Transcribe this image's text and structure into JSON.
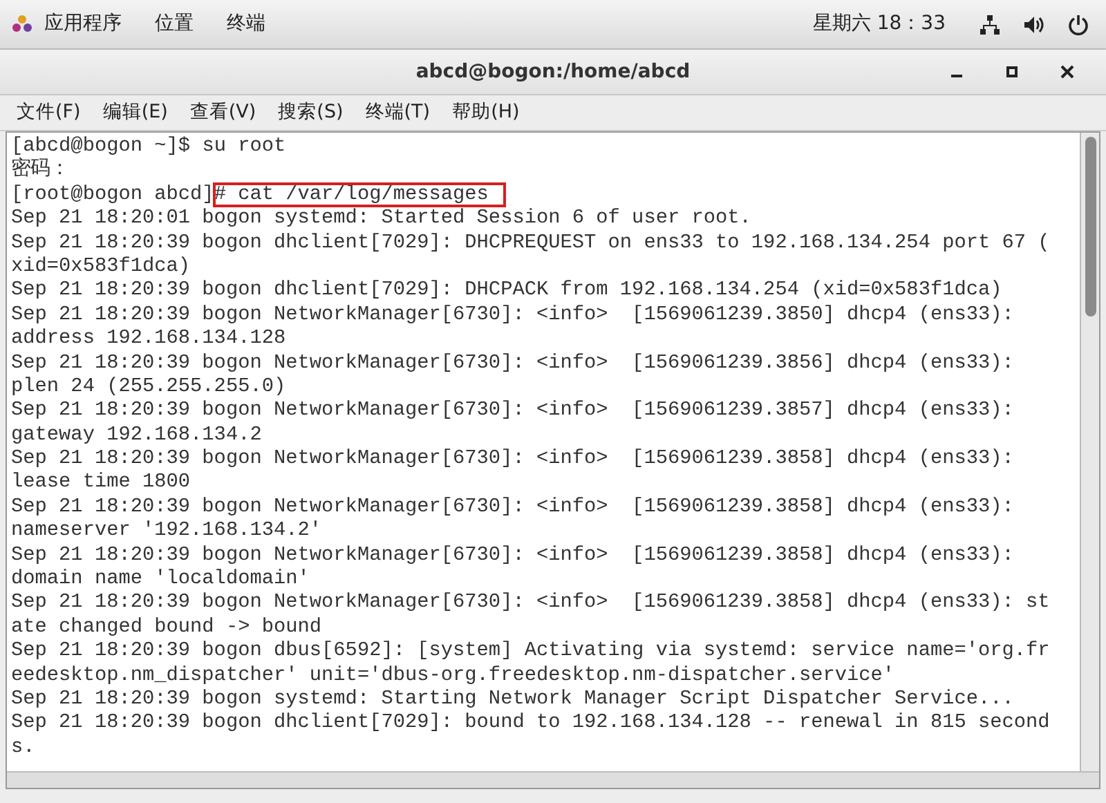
{
  "top_bar": {
    "menus": [
      "应用程序",
      "位置",
      "终端"
    ],
    "clock": "星期六 18：33"
  },
  "window": {
    "title": "abcd@bogon:/home/abcd"
  },
  "menu_bar": [
    "文件(F)",
    "编辑(E)",
    "查看(V)",
    "搜索(S)",
    "终端(T)",
    "帮助(H)"
  ],
  "terminal": {
    "lines": [
      {
        "kind": "prompt",
        "prompt": "[abcd@bogon ~]$ ",
        "command": "su root",
        "highlighted": false
      },
      {
        "kind": "output",
        "text": "密码："
      },
      {
        "kind": "prompt",
        "prompt": "[root@bogon abcd]",
        "command": "# cat /var/log/messages",
        "highlighted": true
      },
      {
        "kind": "output",
        "text": "Sep 21 18:20:01 bogon systemd: Started Session 6 of user root."
      },
      {
        "kind": "output",
        "text": "Sep 21 18:20:39 bogon dhclient[7029]: DHCPREQUEST on ens33 to 192.168.134.254 port 67 ("
      },
      {
        "kind": "output",
        "text": "xid=0x583f1dca)"
      },
      {
        "kind": "output",
        "text": "Sep 21 18:20:39 bogon dhclient[7029]: DHCPACK from 192.168.134.254 (xid=0x583f1dca)"
      },
      {
        "kind": "output",
        "text": "Sep 21 18:20:39 bogon NetworkManager[6730]: <info>  [1569061239.3850] dhcp4 (ens33):"
      },
      {
        "kind": "output",
        "text": "address 192.168.134.128"
      },
      {
        "kind": "output",
        "text": "Sep 21 18:20:39 bogon NetworkManager[6730]: <info>  [1569061239.3856] dhcp4 (ens33):"
      },
      {
        "kind": "output",
        "text": "plen 24 (255.255.255.0)"
      },
      {
        "kind": "output",
        "text": "Sep 21 18:20:39 bogon NetworkManager[6730]: <info>  [1569061239.3857] dhcp4 (ens33):"
      },
      {
        "kind": "output",
        "text": "gateway 192.168.134.2"
      },
      {
        "kind": "output",
        "text": "Sep 21 18:20:39 bogon NetworkManager[6730]: <info>  [1569061239.3858] dhcp4 (ens33):"
      },
      {
        "kind": "output",
        "text": "lease time 1800"
      },
      {
        "kind": "output",
        "text": "Sep 21 18:20:39 bogon NetworkManager[6730]: <info>  [1569061239.3858] dhcp4 (ens33):"
      },
      {
        "kind": "output",
        "text": "nameserver '192.168.134.2'"
      },
      {
        "kind": "output",
        "text": "Sep 21 18:20:39 bogon NetworkManager[6730]: <info>  [1569061239.3858] dhcp4 (ens33):"
      },
      {
        "kind": "output",
        "text": "domain name 'localdomain'"
      },
      {
        "kind": "output",
        "text": "Sep 21 18:20:39 bogon NetworkManager[6730]: <info>  [1569061239.3858] dhcp4 (ens33): st"
      },
      {
        "kind": "output",
        "text": "ate changed bound -> bound"
      },
      {
        "kind": "output",
        "text": "Sep 21 18:20:39 bogon dbus[6592]: [system] Activating via systemd: service name='org.fr"
      },
      {
        "kind": "output",
        "text": "eedesktop.nm_dispatcher' unit='dbus-org.freedesktop.nm-dispatcher.service'"
      },
      {
        "kind": "output",
        "text": "Sep 21 18:20:39 bogon systemd: Starting Network Manager Script Dispatcher Service..."
      },
      {
        "kind": "output",
        "text": "Sep 21 18:20:39 bogon dhclient[7029]: bound to 192.168.134.128 -- renewal in 815 second"
      },
      {
        "kind": "output",
        "text": "s."
      }
    ]
  }
}
